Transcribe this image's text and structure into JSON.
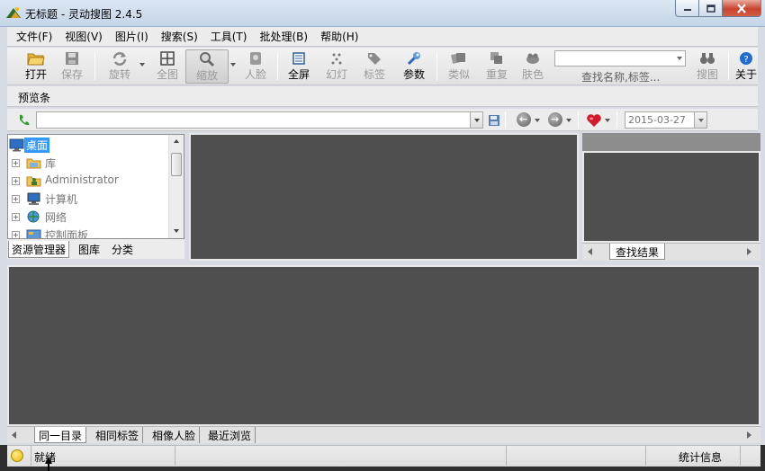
{
  "window": {
    "title": "无标题 - 灵动搜图 2.4.5"
  },
  "menu": [
    "文件(F)",
    "视图(V)",
    "图片(I)",
    "搜索(S)",
    "工具(T)",
    "批处理(B)",
    "帮助(H)"
  ],
  "toolbar": {
    "open": "打开",
    "save": "保存",
    "rotate": "旋转",
    "fit_all": "全图",
    "zoom": "缩放",
    "face": "人脸",
    "fullscreen": "全屏",
    "slideshow": "幻灯",
    "tag": "标签",
    "params": "参数",
    "similar": "类似",
    "duplicate": "重复",
    "skin": "肤色",
    "search_hint": "查找名称,标签...",
    "search_button": "搜图",
    "about": "关于"
  },
  "preview_bar": {
    "label": "预览条"
  },
  "address_bar": {
    "path": "",
    "date": "2015-03-27"
  },
  "tree": {
    "items": [
      "桌面",
      "库",
      "Administrator",
      "计算机",
      "网络",
      "控制面板"
    ]
  },
  "left_tabs": [
    "资源管理器",
    "图库",
    "分类"
  ],
  "right_panel": {
    "tab": "查找结果"
  },
  "bottom_tabs": [
    "同一目录",
    "相同标签",
    "相像人脸",
    "最近浏览"
  ],
  "status": {
    "left": "就绪",
    "right": "统计信息"
  },
  "colors": {
    "panel_dark": "#4f4f4f",
    "selection": "#3399ff",
    "favorite_heart": "#d11b2a"
  }
}
